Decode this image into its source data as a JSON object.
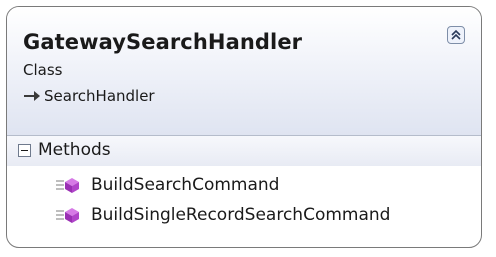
{
  "class": {
    "name": "GatewaySearchHandler",
    "kind": "Class",
    "base": "SearchHandler"
  },
  "sections": [
    {
      "label": "Methods",
      "expanded": true,
      "members": [
        {
          "name": "BuildSearchCommand",
          "icon": "method-icon"
        },
        {
          "name": "BuildSingleRecordSearchCommand",
          "icon": "method-icon"
        }
      ]
    }
  ],
  "colors": {
    "border": "#7a7a7a",
    "header_gradient_end": "#dfe4f1",
    "method_icon": "#b044c9"
  }
}
